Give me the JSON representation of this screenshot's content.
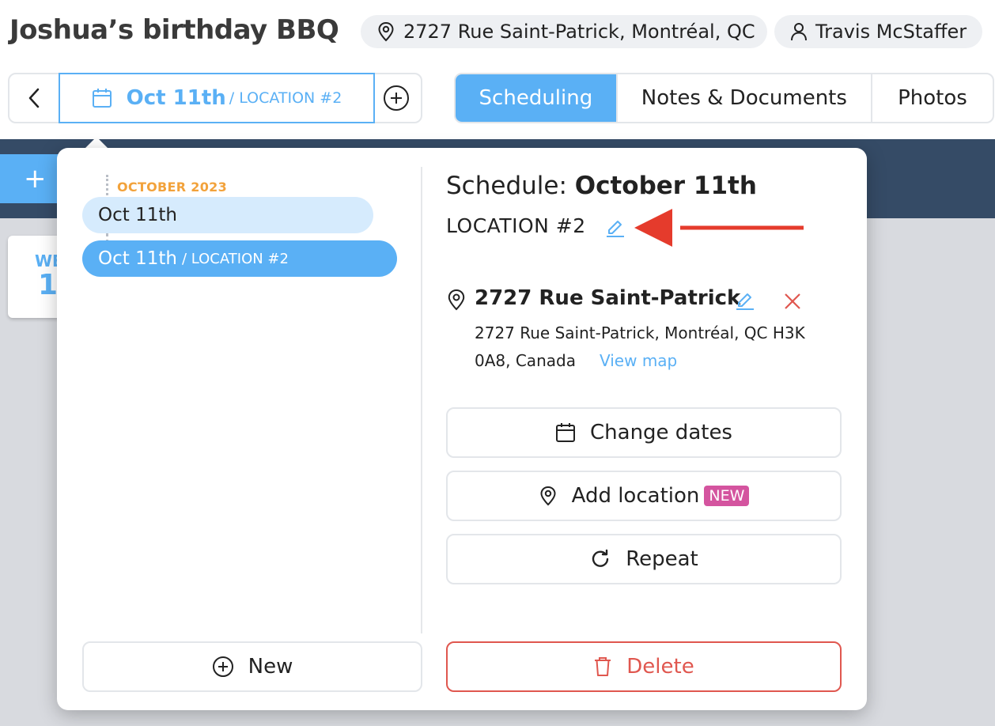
{
  "event": {
    "title": "Joshua’s birthday BBQ"
  },
  "header": {
    "address": "2727 Rue Saint-Patrick, Montréal, QC",
    "staff": "Travis McStaffer"
  },
  "date_nav": {
    "current_date": "Oct 11th",
    "current_location": "/ LOCATION #2"
  },
  "tabs": [
    {
      "label": "Scheduling",
      "active": true
    },
    {
      "label": "Notes & Documents",
      "active": false
    },
    {
      "label": "Photos",
      "active": false
    }
  ],
  "background": {
    "add_label": "+",
    "day_abbr": "WE",
    "day_num": "1"
  },
  "schedule_list": {
    "month": "OCTOBER 2023",
    "items": [
      {
        "date": "Oct 11th",
        "location": ""
      },
      {
        "date": "Oct 11th",
        "location": "/ LOCATION #2",
        "selected": true
      }
    ],
    "new_label": "New"
  },
  "detail": {
    "title_prefix": "Schedule: ",
    "title_date": "October 11th",
    "location_name": "LOCATION #2",
    "address_name": "2727 Rue Saint-Patrick",
    "address_line1": "2727 Rue Saint-Patrick, Montréal, QC H3K",
    "address_line2": "0A8, Canada",
    "view_map": "View map",
    "change_dates": "Change dates",
    "add_location": "Add location",
    "new_badge": "NEW",
    "repeat": "Repeat",
    "delete": "Delete"
  },
  "colors": {
    "accent": "#5ab0f5",
    "highlight": "#f2a23b",
    "danger": "#e0574f",
    "badge": "#d4549f",
    "annotation_arrow": "#e53b2c",
    "header_band": "#354b66"
  },
  "icons": [
    "pin-icon",
    "person-icon",
    "chevron-left-icon",
    "calendar-icon",
    "plus-circle-icon",
    "pencil-icon",
    "close-icon",
    "repeat-icon",
    "trash-icon"
  ]
}
